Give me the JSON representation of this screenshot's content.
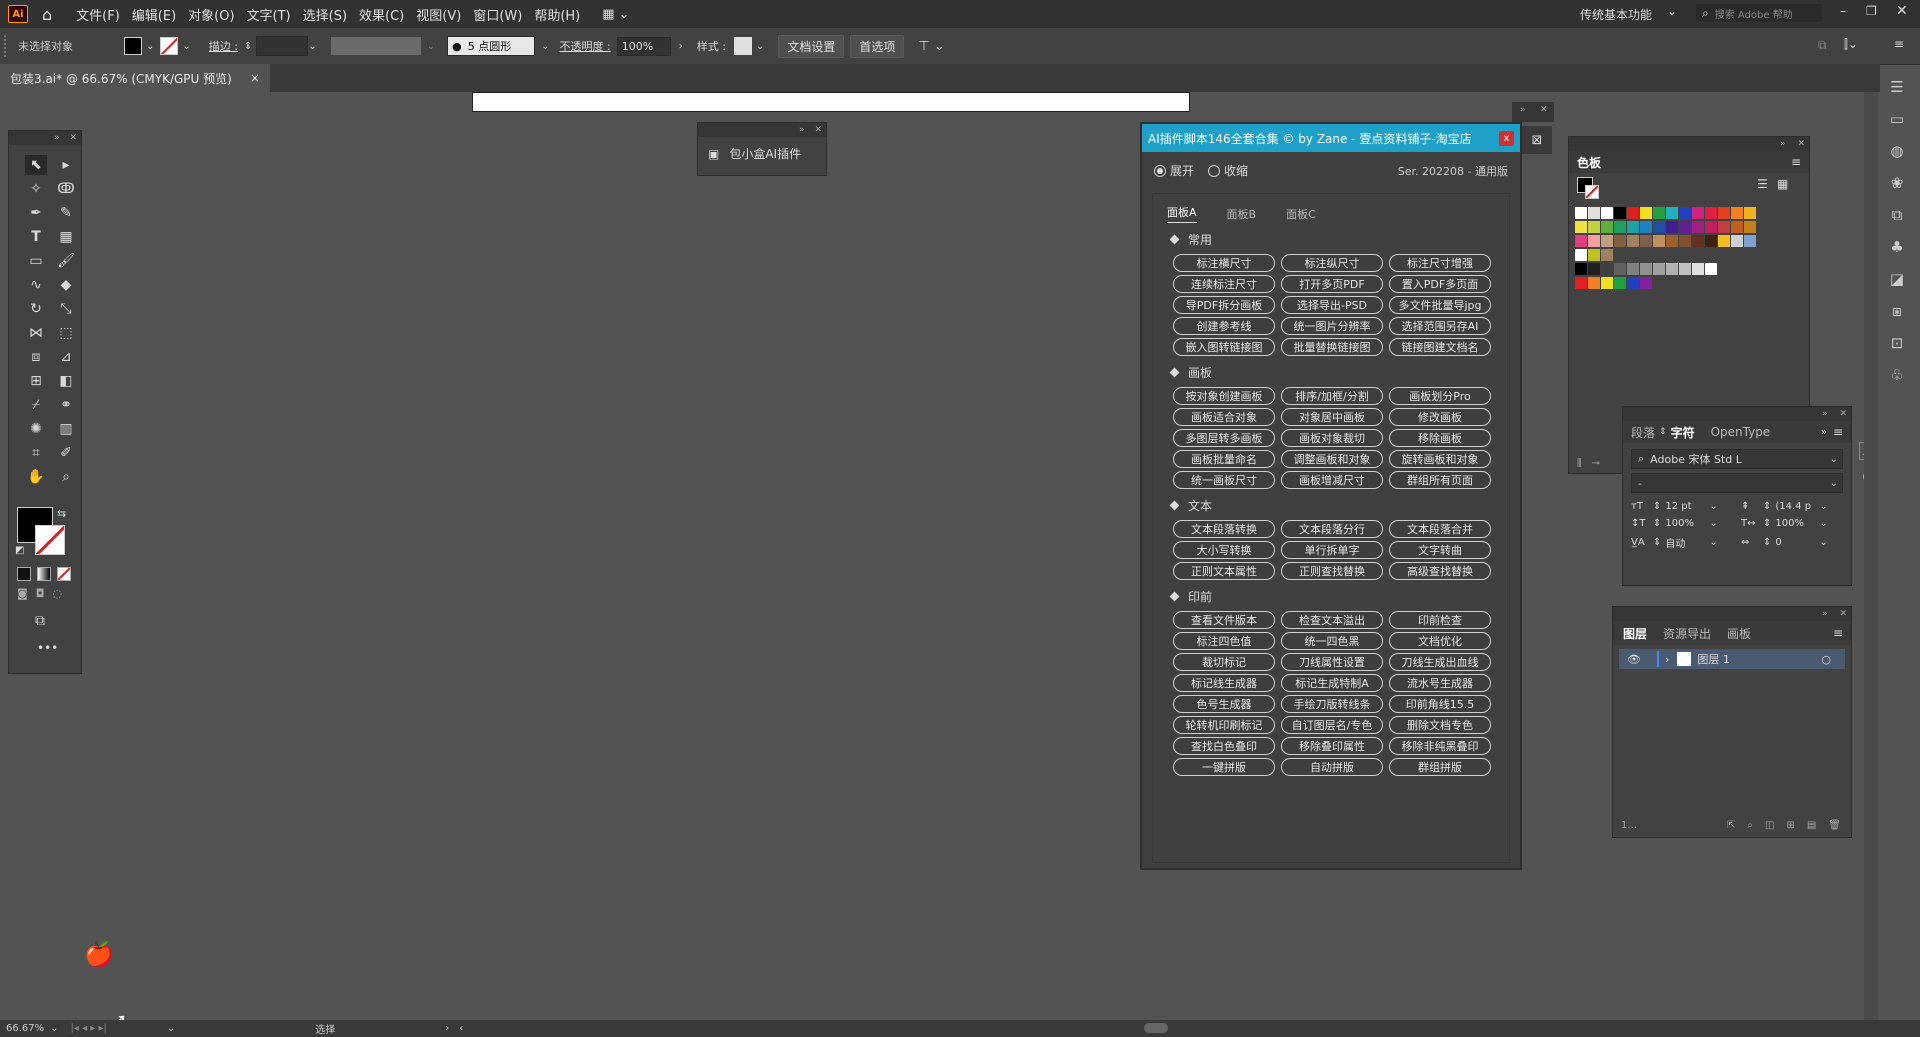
{
  "menubar": {
    "logo": "Ai",
    "items": [
      "文件(F)",
      "编辑(E)",
      "对象(O)",
      "文字(T)",
      "选择(S)",
      "效果(C)",
      "视图(V)",
      "窗口(W)",
      "帮助(H)"
    ],
    "workspace": "传统基本功能",
    "search_placeholder": "搜索 Adobe 帮助"
  },
  "controlbar": {
    "selection": "未选择对象",
    "stroke_label": "描边 :",
    "brush": "5 点圆形",
    "opacity_label": "不透明度 :",
    "opacity_value": "100%",
    "style_label": "样式 :",
    "doc_settings": "文档设置",
    "preferences": "首选项"
  },
  "tab": {
    "title": "包装3.ai* @ 66.67% (CMYK/GPU 预览)",
    "close": "×"
  },
  "floating_panel": {
    "label": "包小盒AI插件"
  },
  "plugin": {
    "title": "AI插件脚本146全套合集 © by Zane - 壹点资料铺子-淘宝店",
    "close": "x",
    "radio_expand": "展开",
    "radio_collapse": "收缩",
    "version": "Ser. 202208 - 通用版",
    "tabs": [
      "面板A",
      "面板B",
      "面板C"
    ],
    "sections": [
      {
        "title": "常用",
        "rows": [
          [
            "标注横尺寸",
            "标注纵尺寸",
            "标注尺寸增强"
          ],
          [
            "连续标注尺寸",
            "打开多页PDF",
            "置入PDF多页面"
          ],
          [
            "导PDF拆分画板",
            "选择导出-PSD",
            "多文件批量导jpg"
          ],
          [
            "创建参考线",
            "统一图片分辨率",
            "选择范围另存AI"
          ],
          [
            "嵌入图转链接图",
            "批量替换链接图",
            "链接图建文档名"
          ]
        ]
      },
      {
        "title": "画板",
        "rows": [
          [
            "按对象创建画板",
            "排序/加框/分割",
            "画板划分Pro"
          ],
          [
            "画板适合对象",
            "对象居中画板",
            "修改画板"
          ],
          [
            "多图层转多画板",
            "画板对象裁切",
            "移除画板"
          ],
          [
            "画板批量命名",
            "调整画板和对象",
            "旋转画板和对象"
          ],
          [
            "统一画板尺寸",
            "画板增减尺寸",
            "群组所有页面"
          ]
        ]
      },
      {
        "title": "文本",
        "rows": [
          [
            "文本段落转换",
            "文本段落分行",
            "文本段落合并"
          ],
          [
            "大小写转换",
            "单行拆单字",
            "文字转曲"
          ],
          [
            "正则文本属性",
            "正则查找替换",
            "高级查找替换"
          ]
        ]
      },
      {
        "title": "印前",
        "rows": [
          [
            "查看文件版本",
            "检查文本溢出",
            "印前检查"
          ],
          [
            "标注四色值",
            "统一四色黑",
            "文档优化"
          ],
          [
            "裁切标记",
            "刀线属性设置",
            "刀线生成出血线"
          ],
          [
            "标记线生成器",
            "标记生成特制A",
            "流水号生成器"
          ],
          [
            "色号生成器",
            "手绘刀版转线条",
            "印前角线15.5"
          ],
          [
            "轮转机印刷标记",
            "自订图层名/专色",
            "删除文档专色"
          ],
          [
            "查找白色叠印",
            "移除叠印属性",
            "移除非纯黑叠印"
          ],
          [
            "一键拼版",
            "自动拼版",
            "群组拼版"
          ]
        ]
      }
    ]
  },
  "swatches_panel": {
    "title": "色板"
  },
  "character_panel": {
    "tabs": [
      "段落",
      "字符",
      "OpenType"
    ],
    "font": "Adobe 宋体 Std L",
    "style": "-",
    "size": "12 pt",
    "leading": "(14.4 p",
    "vscale": "100%",
    "hscale": "100%",
    "kerning": "自动",
    "tracking": "0"
  },
  "layers_panel": {
    "tabs": [
      "图层",
      "资源导出",
      "画板"
    ],
    "layer_name": "图层 1",
    "footer": "1..."
  },
  "statusbar": {
    "zoom": "66.67%",
    "mode": "选择"
  },
  "colors": {
    "accent": "#1ea0c8",
    "close": "#d03030"
  }
}
